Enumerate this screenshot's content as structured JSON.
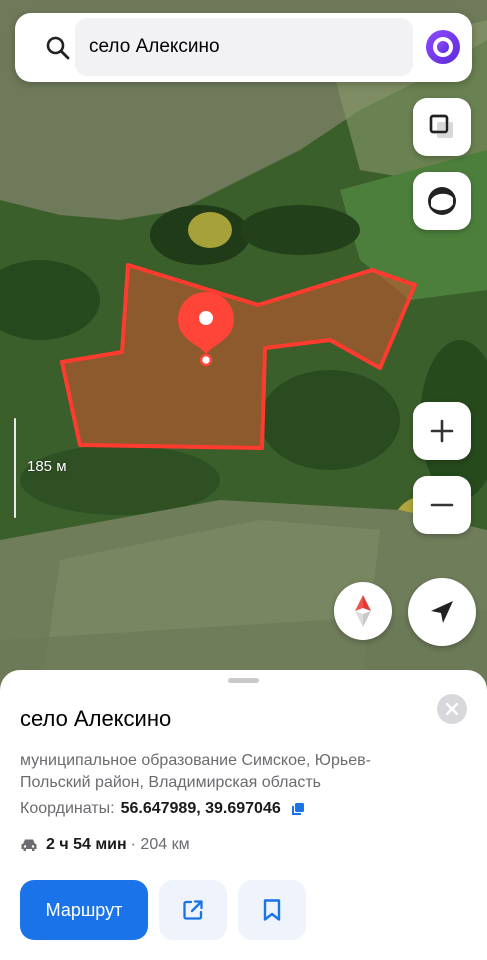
{
  "search": {
    "query": "село Алексино"
  },
  "map": {
    "scale_label": "185 м"
  },
  "place": {
    "title": "село Алексино",
    "address": "муниципальное образование Симское, Юрьев-Польский район, Владимирская область",
    "coords_label": "Координаты:",
    "coords_value": "56.647989, 39.697046",
    "travel_time": "2 ч 54 мин",
    "travel_distance": "· 204 км"
  },
  "actions": {
    "route_label": "Маршрут"
  },
  "colors": {
    "accent": "#1a73e8",
    "alice": "#7a3cf0",
    "boundary": "#ff3b30",
    "pin": "#ff4438"
  }
}
